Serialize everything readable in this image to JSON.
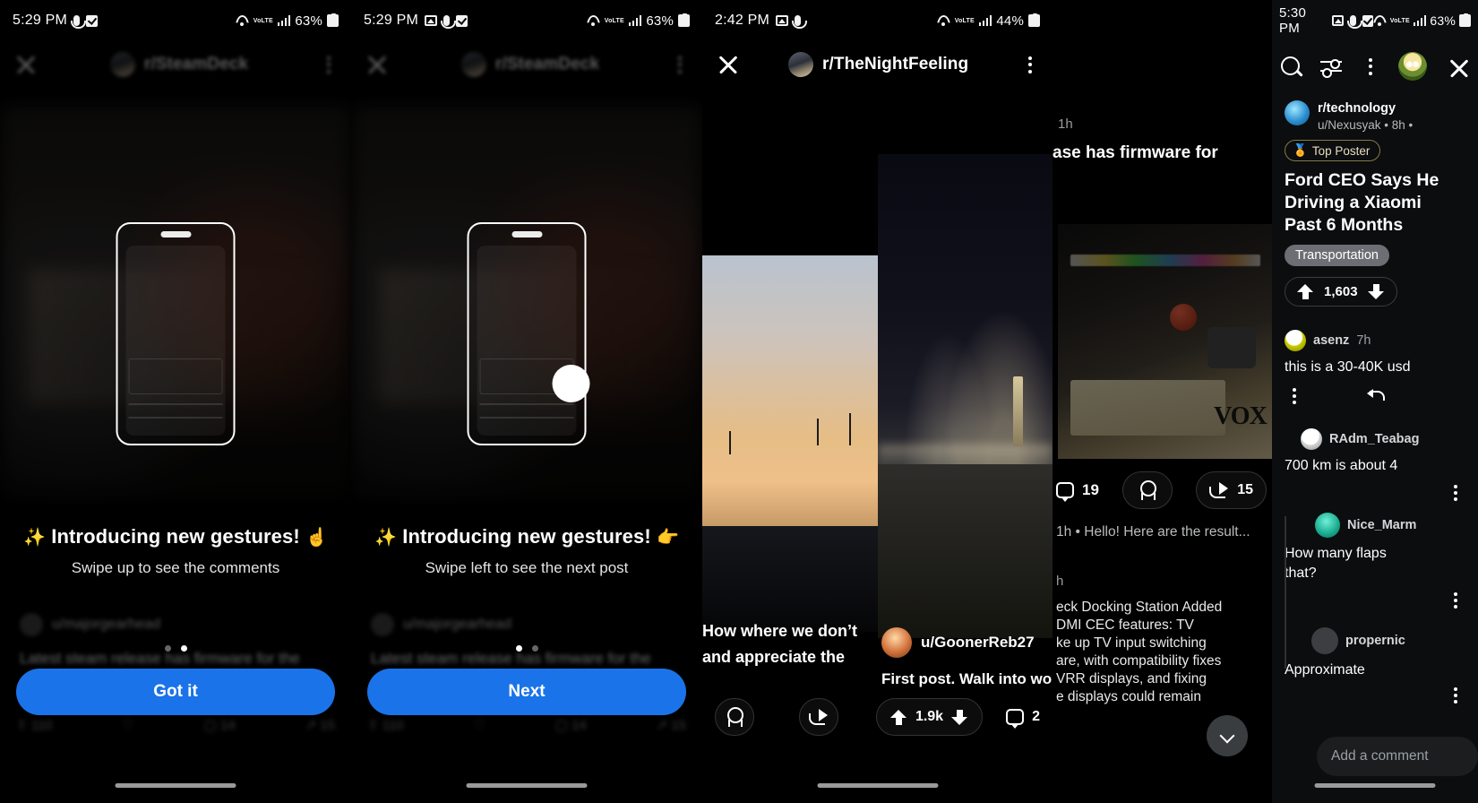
{
  "panels": [
    {
      "id": "gesture-coach-1",
      "status": {
        "time": "5:29 PM",
        "battery": "63%",
        "network": "LTE"
      },
      "appbar": {
        "subreddit": "r/SteamDeck"
      },
      "coach": {
        "heading": "Introducing new gestures!",
        "emoji_left": "✨",
        "emoji_right": "☝️",
        "subtext": "Swipe up to see the comments",
        "cta_label": "Got it",
        "page_index": 2,
        "page_count": 2
      },
      "background_post": {
        "author": "u/majorgearhead",
        "title": "Latest steam release has firmware for the"
      }
    },
    {
      "id": "gesture-coach-2",
      "status": {
        "time": "5:29 PM",
        "battery": "63%",
        "network": "LTE"
      },
      "appbar": {
        "subreddit": "r/SteamDeck"
      },
      "coach": {
        "heading": "Introducing new gestures!",
        "emoji_left": "✨",
        "emoji_right": "👉",
        "subtext": "Swipe left to see the next post",
        "cta_label": "Next",
        "page_index": 1,
        "page_count": 2
      },
      "background_post": {
        "author": "u/majorgearhead",
        "title": "Latest steam release has firmware for the"
      }
    },
    {
      "id": "post-thenightfeeling",
      "status": {
        "time": "2:42 PM",
        "battery": "44%",
        "network": "LTE"
      },
      "appbar": {
        "subreddit": "r/TheNightFeeling"
      },
      "post": {
        "title_line1": "How where we don’t",
        "title_line2": "and appreciate the",
        "author": "u/GoonerReb27",
        "caption": "First post. Walk into wor",
        "votes": "1.9k",
        "comments": "2"
      }
    },
    {
      "id": "post-steamdeck-firmware",
      "status": {
        "time": "2:42 PM",
        "battery": "44%"
      },
      "post": {
        "timestamp": "1h",
        "title_partial": "ase has firmware for",
        "comments": "19",
        "share": "15",
        "op_comment": "1h •  Hello! Here are the result...",
        "body_lines": [
          "eck Docking Station Added",
          "DMI CEC features: TV",
          "ke up TV input switching",
          "are, with compatibility fixes",
          "VRR displays, and fixing",
          "e displays could remain"
        ]
      }
    },
    {
      "id": "feed-technology",
      "status": {
        "time": "5:30 PM",
        "battery": "63%",
        "network": "LTE"
      },
      "toolbar": {
        "search_icon": "search-icon",
        "sort_icon": "sort-icon",
        "overflow_icon": "kebab-icon",
        "avatar_icon": "user-avatar",
        "close_icon": "close-icon"
      },
      "post": {
        "subreddit": "r/technology",
        "author_meta": "u/Nexusyak • 8h •",
        "badge": "Top Poster",
        "badge_emoji": "🏅",
        "title_lines": [
          "Ford CEO Says He",
          "Driving a Xiaomi",
          "Past 6 Months"
        ],
        "flair": "Transportation",
        "votes": "1,603"
      },
      "comments": [
        {
          "author": "asenz",
          "age": "7h",
          "body": "this is a 30-40K usd"
        },
        {
          "author": "RAdm_Teabag",
          "age": "",
          "body": "700 km is about 4"
        },
        {
          "author": "Nice_Marm",
          "age": "",
          "body": "How many flaps",
          "body2": "that?"
        },
        {
          "author": "propernic",
          "age": "",
          "body": "Approximate"
        }
      ],
      "composer": {
        "placeholder": "Add a comment"
      }
    }
  ],
  "colors": {
    "accent_blue": "#1a73e8",
    "background": "#000000",
    "flair_grey": "#6b6f73",
    "badge_border": "#8a7a46"
  }
}
